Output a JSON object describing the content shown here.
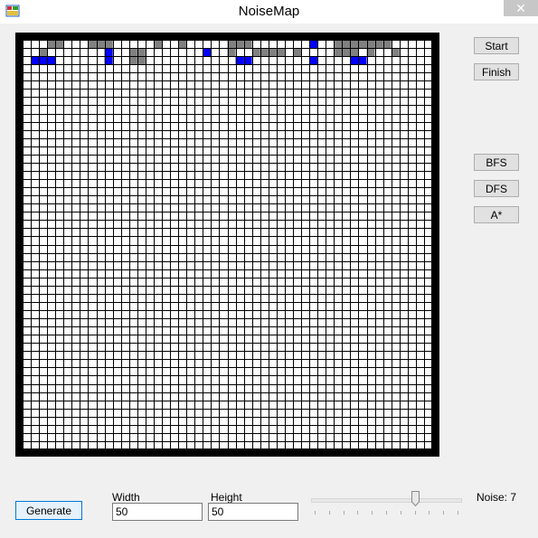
{
  "window": {
    "title": "NoiseMap",
    "close_glyph": "✕",
    "icon": "app-icon"
  },
  "map": {
    "columns": 50,
    "rows": 50,
    "colors": {
      "empty": "#ffffff",
      "wall": "#808080",
      "water": "#0000ff",
      "gridline": "#000000"
    },
    "tiles": [
      "00022000222000002002000002220000000100222222200000",
      "00200000001002200000001002002222020000222020020000",
      "01110000001002200000000000110000000100001100000000",
      "00000000000000000000000000000000000000000000000000",
      "00000000000000000000000000000000000000000000000000",
      "00000000000000000000000000000000000000000000000000",
      "00000000000000000000000000000000000000000000000000",
      "00000000000000000000000000000000000000000000000000",
      "00000000000000000000000000000000000000000000000000",
      "00000000000000000000000000000000000000000000000000"
    ]
  },
  "sidebar": {
    "start_label": "Start",
    "finish_label": "Finish",
    "bfs_label": "BFS",
    "dfs_label": "DFS",
    "astar_label": "A*"
  },
  "controls": {
    "generate_label": "Generate",
    "width_label": "Width",
    "width_value": "50",
    "height_label": "Height",
    "height_value": "50",
    "noise_label": "Noise: 7",
    "noise_value": 7,
    "noise_min": 0,
    "noise_max": 10
  }
}
